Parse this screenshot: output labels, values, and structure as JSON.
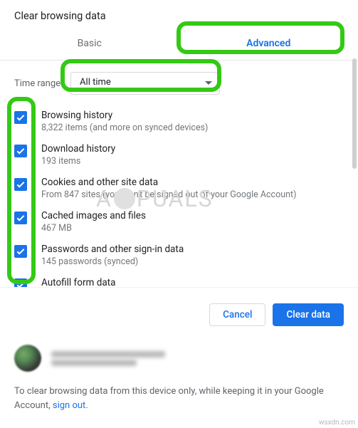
{
  "dialog": {
    "title": "Clear browsing data"
  },
  "tabs": {
    "basic": "Basic",
    "advanced": "Advanced"
  },
  "time": {
    "label": "Time range",
    "selected": "All time"
  },
  "items": [
    {
      "title": "Browsing history",
      "sub": "8,322 items (and more on synced devices)",
      "checked": true
    },
    {
      "title": "Download history",
      "sub": "193 items",
      "checked": true
    },
    {
      "title": "Cookies and other site data",
      "sub": "From 847 sites (you won't be signed out of your Google Account)",
      "checked": true
    },
    {
      "title": "Cached images and files",
      "sub": "467 MB",
      "checked": true
    },
    {
      "title": "Passwords and other sign-in data",
      "sub": "145 passwords (synced)",
      "checked": true
    },
    {
      "title": "Autofill form data",
      "sub": "",
      "checked": true
    }
  ],
  "actions": {
    "cancel": "Cancel",
    "confirm": "Clear data"
  },
  "footer": {
    "text_before": "To clear browsing data from this device only, while keeping it in your Google Account, ",
    "link": "sign out",
    "text_after": "."
  },
  "watermark": {
    "left": "A",
    "right": "PUALS"
  },
  "site_tag": "wsxdn.com",
  "colors": {
    "accent": "#1a73e8",
    "highlight": "#34c914"
  }
}
